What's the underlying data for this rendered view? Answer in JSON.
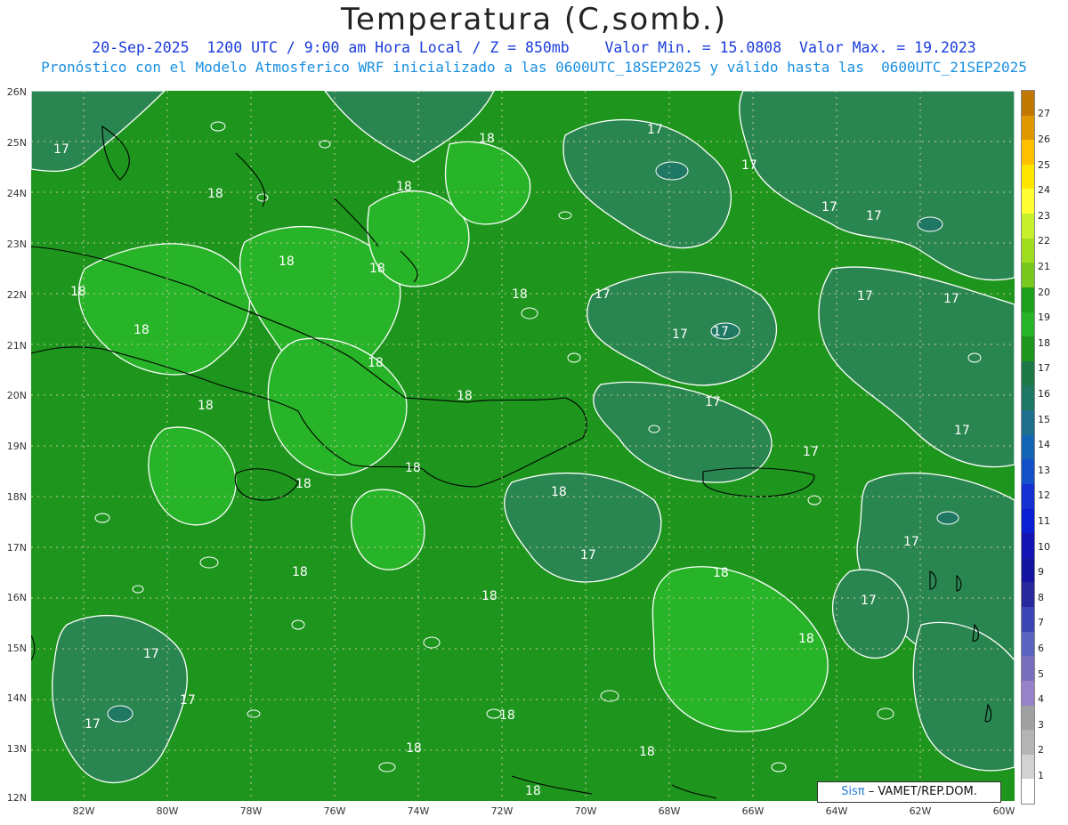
{
  "title": "Temperatura (C,somb.)",
  "subtitle1": "20-Sep-2025  1200 UTC / 9:00 am Hora Local / Z = 850mb    Valor Min. = 15.0808  Valor Max. = 19.2023",
  "subtitle2": "Pronóstico con el Modelo Atmosferico WRF inicializado a las 0600UTC_18SEP2025 y válido hasta las  0600UTC_21SEP2025",
  "lat_labels": [
    "26N",
    "25N",
    "24N",
    "23N",
    "22N",
    "21N",
    "20N",
    "19N",
    "18N",
    "17N",
    "16N",
    "15N",
    "14N",
    "13N",
    "12N"
  ],
  "lon_labels": [
    "82W",
    "80W",
    "78W",
    "76W",
    "74W",
    "72W",
    "70W",
    "68W",
    "66W",
    "64W",
    "62W",
    "60W"
  ],
  "colorbar": {
    "labels": [
      "27",
      "26",
      "25",
      "24",
      "23",
      "22",
      "21",
      "20",
      "19",
      "18",
      "17",
      "16",
      "15",
      "14",
      "13",
      "12",
      "11",
      "10",
      "9",
      "8",
      "7",
      "6",
      "5",
      "4",
      "3",
      "2",
      "1"
    ],
    "colors": [
      "#c07800",
      "#e09800",
      "#ffc000",
      "#ffe600",
      "#ffff33",
      "#c8f02a",
      "#a0dc1e",
      "#78c81e",
      "#1ea01e",
      "#28b428",
      "#1e961e",
      "#1e7846",
      "#1e7864",
      "#1e6e8c",
      "#1464b4",
      "#1450c8",
      "#1432d2",
      "#0a1ed2",
      "#1414b4",
      "#1414a0",
      "#28289c",
      "#3c46b4",
      "#5a64be",
      "#786ebe",
      "#9682c8",
      "#a0a0a0",
      "#b4b4b4",
      "#d2d2d2",
      "#ffffff"
    ]
  },
  "contour_labels": [
    {
      "text": "17"
    },
    {
      "text": "18"
    },
    {
      "text": "18"
    },
    {
      "text": "18"
    },
    {
      "text": "18"
    },
    {
      "text": "18"
    },
    {
      "text": "17"
    },
    {
      "text": "17"
    },
    {
      "text": "17"
    },
    {
      "text": "17"
    },
    {
      "text": "18"
    },
    {
      "text": "18"
    },
    {
      "text": "18"
    },
    {
      "text": "18"
    },
    {
      "text": "17"
    },
    {
      "text": "17"
    },
    {
      "text": "17"
    },
    {
      "text": "17"
    },
    {
      "text": "17"
    },
    {
      "text": "17"
    },
    {
      "text": "18"
    },
    {
      "text": "18"
    },
    {
      "text": "17"
    },
    {
      "text": "18"
    },
    {
      "text": "18"
    },
    {
      "text": "18"
    },
    {
      "text": "17"
    },
    {
      "text": "17"
    },
    {
      "text": "18"
    },
    {
      "text": "17"
    },
    {
      "text": "17"
    },
    {
      "text": "18"
    },
    {
      "text": "18"
    },
    {
      "text": "18"
    },
    {
      "text": "17"
    },
    {
      "text": "17"
    },
    {
      "text": "17"
    },
    {
      "text": "18"
    },
    {
      "text": "18"
    },
    {
      "text": "18"
    },
    {
      "text": "18"
    }
  ],
  "credit": {
    "part1": "Sisπ",
    "part2": " –   VAMET/REP.DOM."
  }
}
